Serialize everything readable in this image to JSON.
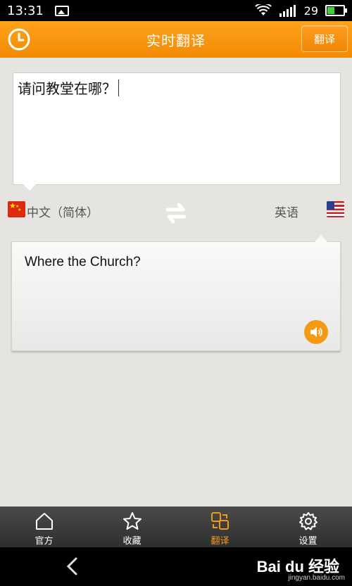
{
  "status_bar": {
    "time": "13:31",
    "battery": "29",
    "battery_level": 0.45,
    "icons": [
      "image-icon",
      "wifi-icon",
      "signal-icon",
      "battery-icon"
    ]
  },
  "header": {
    "title": "实时翻译",
    "translate_button": "翻译",
    "left_icon": "clock-icon"
  },
  "input": {
    "text": "请问教堂在哪？"
  },
  "languages": {
    "source": "中文（简体）",
    "target": "英语",
    "swap_icon": "swap-arrows-icon"
  },
  "output": {
    "text": "Where the Church?",
    "speaker_icon": "speaker-icon"
  },
  "tabs": [
    {
      "label": "官方",
      "icon": "home-icon",
      "active": false
    },
    {
      "label": "收藏",
      "icon": "star-icon",
      "active": false
    },
    {
      "label": "翻译",
      "icon": "translate-icon",
      "active": true
    },
    {
      "label": "设置",
      "icon": "gear-icon",
      "active": false
    }
  ],
  "nav": {
    "watermark": "Bai du 经验",
    "watermark_sub": "jingyan.baidu.com"
  },
  "colors": {
    "accent": "#f39a14",
    "header": "#f38a04",
    "tabbar": "#3a3a3a"
  }
}
